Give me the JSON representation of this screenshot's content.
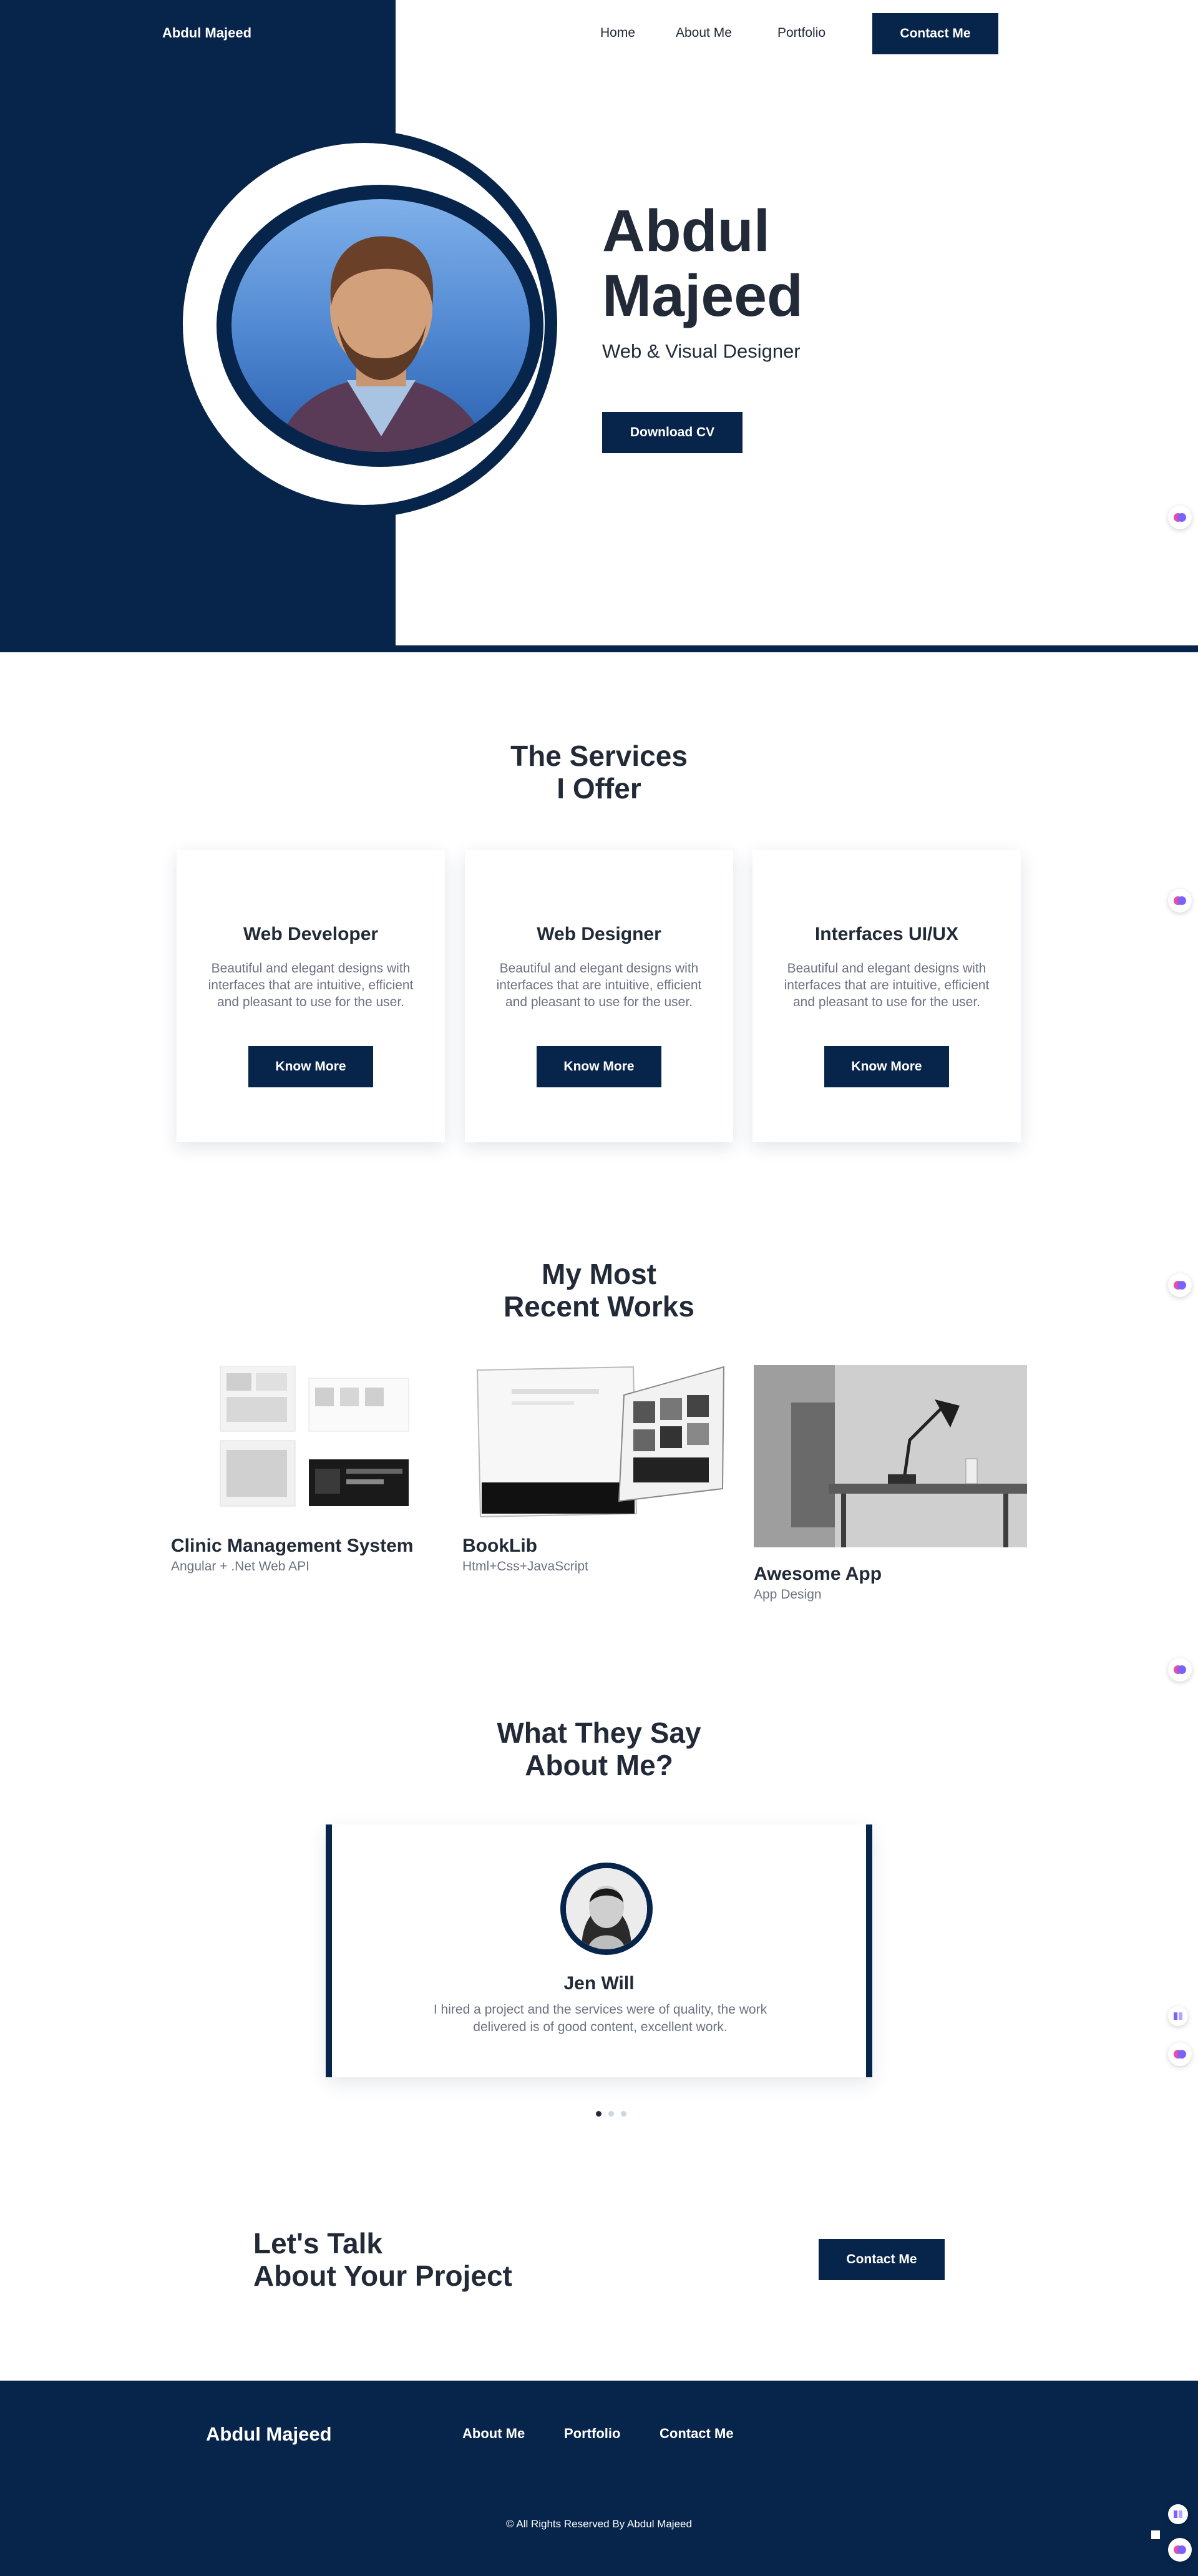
{
  "nav": {
    "brand": "Abdul Majeed",
    "home": "Home",
    "about": "About Me",
    "portfolio": "Portfolio",
    "contact": "Contact Me"
  },
  "hero": {
    "name_line1": "Abdul",
    "name_line2": "Majeed",
    "subtitle": "Web & Visual Designer",
    "cta": "Download CV"
  },
  "services": {
    "title_line1": "The Services",
    "title_line2": "I Offer",
    "cards": [
      {
        "title": "Web Developer",
        "text": "Beautiful and elegant designs with interfaces that are intuitive, efficient and pleasant to use for the user.",
        "button": "Know More"
      },
      {
        "title": "Web Designer",
        "text": "Beautiful and elegant designs with interfaces that are intuitive, efficient and pleasant to use for the user.",
        "button": "Know More"
      },
      {
        "title": "Interfaces UI/UX",
        "text": "Beautiful and elegant designs with interfaces that are intuitive, efficient and pleasant to use for the user.",
        "button": "Know More"
      }
    ]
  },
  "works": {
    "title_line1": "My Most",
    "title_line2": "Recent Works",
    "items": [
      {
        "title": "Clinic Management System",
        "subtitle": "Angular + .Net Web API"
      },
      {
        "title": "BookLib",
        "subtitle": "Html+Css+JavaScript"
      },
      {
        "title": "Awesome App",
        "subtitle": "App Design"
      }
    ]
  },
  "testimonials": {
    "title_line1": "What They Say",
    "title_line2": "About Me?",
    "name": "Jen Will",
    "quote": "I hired a project and the services were of quality, the work delivered is of good content, excellent work."
  },
  "cta": {
    "line1": "Let's Talk",
    "line2": "About Your Project",
    "button": "Contact Me"
  },
  "footer": {
    "brand": "Abdul Majeed",
    "about": "About Me",
    "portfolio": "Portfolio",
    "contact": "Contact Me",
    "copyright": "© All Rights Reserved By Abdul Majeed"
  },
  "colors": {
    "navy": "#07244a",
    "text": "#222a37",
    "muted": "#6b7280"
  }
}
